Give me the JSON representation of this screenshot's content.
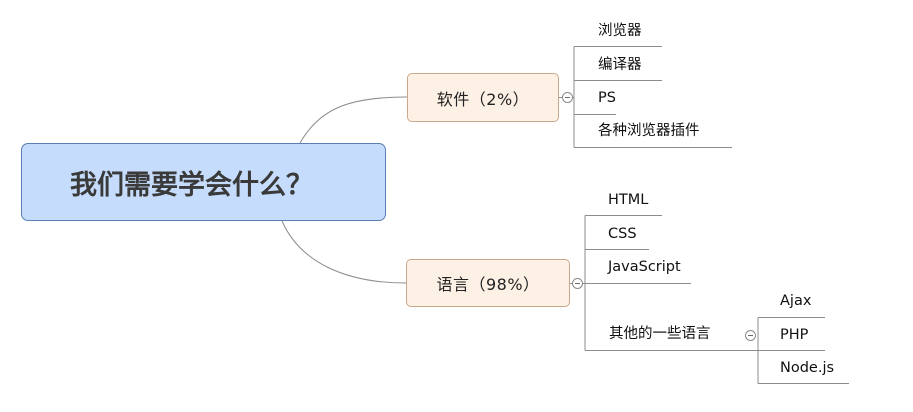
{
  "root": {
    "label": "我们需要学会什么？"
  },
  "software": {
    "label": "软件（2%）",
    "children": [
      "浏览器",
      "编译器",
      "PS",
      "各种浏览器插件"
    ]
  },
  "language": {
    "label": "语言（98%）",
    "children": [
      "HTML",
      "CSS",
      "JavaScript",
      "其他的一些语言"
    ],
    "other": {
      "children": [
        "Ajax",
        "PHP",
        "Node.js"
      ]
    }
  },
  "colors": {
    "root_fill": "#c6dcfc",
    "root_border": "#5a7fb4",
    "topic_fill": "#fdf1e6",
    "topic_border": "#c9a78b",
    "connector": "#8c8c8c"
  },
  "icons": {
    "collapse": "collapse-minus-icon"
  }
}
